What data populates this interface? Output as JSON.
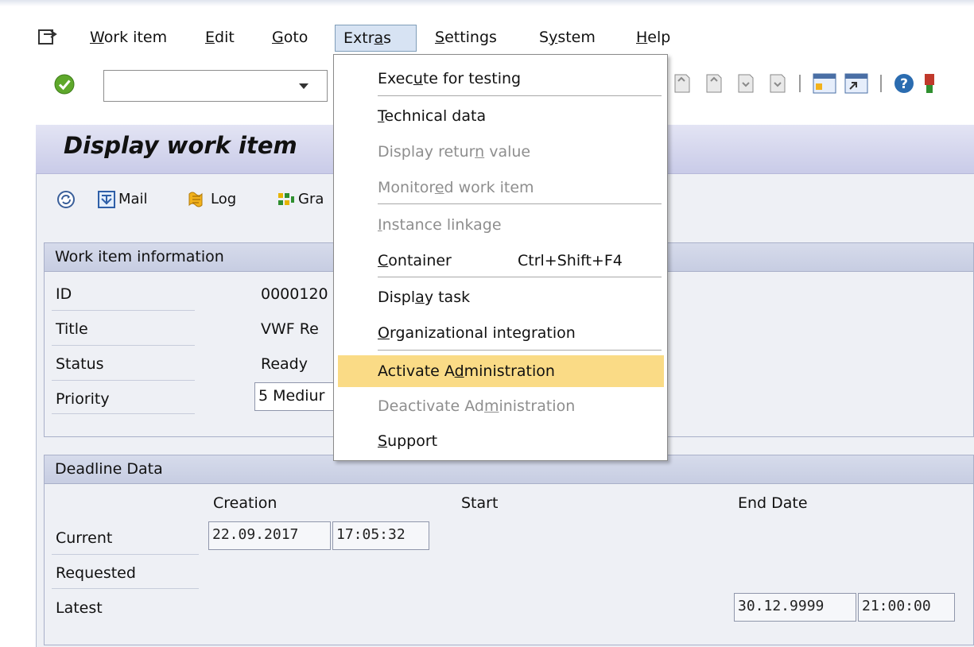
{
  "menubar": {
    "items": [
      {
        "pre": "",
        "u": "W",
        "post": "ork item"
      },
      {
        "pre": "",
        "u": "E",
        "post": "dit"
      },
      {
        "pre": "",
        "u": "G",
        "post": "oto"
      },
      {
        "pre": "Extr",
        "u": "a",
        "post": "s"
      },
      {
        "pre": "",
        "u": "S",
        "post": "ettings"
      },
      {
        "pre": "S",
        "u": "y",
        "post": "stem"
      },
      {
        "pre": "",
        "u": "H",
        "post": "elp"
      }
    ]
  },
  "toolbar": {
    "command_value": ""
  },
  "page": {
    "title": "Display work item"
  },
  "app_toolbar": {
    "mail_label": "Mail",
    "log_label": "Log",
    "graphic_label": "Gra"
  },
  "work_item_info": {
    "heading": "Work item information",
    "rows": [
      {
        "label": "ID",
        "value": "0000120"
      },
      {
        "label": "Title",
        "value": "VWF Re"
      },
      {
        "label": "Status",
        "value": "Ready"
      },
      {
        "label": "Priority",
        "value": "5 Mediur"
      }
    ]
  },
  "deadline": {
    "heading": "Deadline Data",
    "columns": [
      "Creation",
      "Start",
      "End Date"
    ],
    "rows": [
      "Current",
      "Requested",
      "Latest"
    ],
    "current_creation_date": "22.09.2017",
    "current_creation_time": "17:05:32",
    "latest_end_date": "30.12.9999",
    "latest_end_time": "21:00:00"
  },
  "extras_menu": {
    "items": [
      {
        "pre": "Exec",
        "u": "u",
        "post": "te for testing",
        "disabled": false
      },
      {
        "pre": "",
        "u": "T",
        "post": "echnical data",
        "disabled": false
      },
      {
        "pre": "Display retur",
        "u": "n",
        "post": " value",
        "disabled": true
      },
      {
        "pre": "Monitor",
        "u": "e",
        "post": "d work item",
        "disabled": true
      },
      {
        "pre": "",
        "u": "I",
        "post": "nstance linkage",
        "disabled": true
      },
      {
        "pre": "",
        "u": "C",
        "post": "ontainer",
        "shortcut": "Ctrl+Shift+F4",
        "disabled": false
      },
      {
        "pre": "Displ",
        "u": "a",
        "post": "y task",
        "disabled": false
      },
      {
        "pre": "",
        "u": "O",
        "post": "rganizational integration",
        "disabled": false
      },
      {
        "pre": "Activate A",
        "u": "d",
        "post": "ministration",
        "disabled": false,
        "highlighted": true
      },
      {
        "pre": "Deactivate Ad",
        "u": "m",
        "post": "inistration",
        "disabled": true
      },
      {
        "pre": "",
        "u": "S",
        "post": "upport",
        "disabled": false
      }
    ]
  },
  "colors": {
    "highlight": "#fadb86",
    "title_bar": "#cfd1ec",
    "disabled_text": "#8e8e8e"
  }
}
